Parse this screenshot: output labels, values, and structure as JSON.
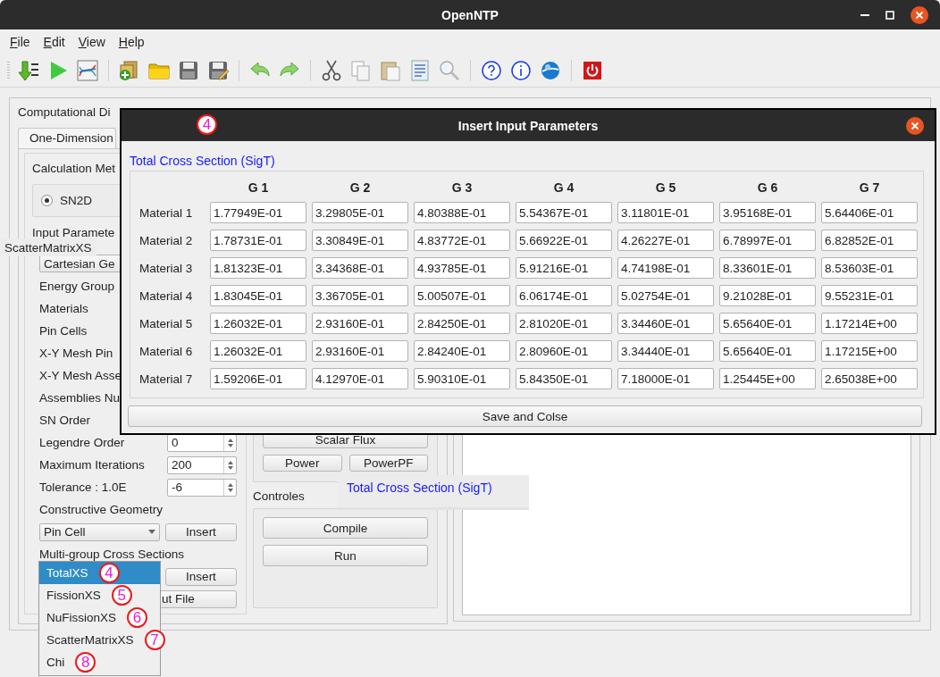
{
  "window": {
    "title": "OpenNTP"
  },
  "menu": [
    "File",
    "Edit",
    "View",
    "Help"
  ],
  "main": {
    "group_title": "Computational Di",
    "tabs": [
      {
        "label": "One-Dimension",
        "selected": true
      }
    ],
    "calculation_method": {
      "label": "Calculation Met",
      "options": [
        {
          "label": "SN2D",
          "selected": true
        }
      ]
    },
    "input_parameters": {
      "label": "Input Paramete",
      "geometry_combo": "Cartesian Ge",
      "fields": [
        {
          "label": "Energy Group"
        },
        {
          "label": "Materials"
        },
        {
          "label": "Pin Cells"
        },
        {
          "label": "X-Y Mesh Pin"
        },
        {
          "label": "X-Y Mesh Asse"
        },
        {
          "label": "Assemblies Nu"
        },
        {
          "label": "SN Order"
        },
        {
          "label": "Legendre Order",
          "value": "0"
        },
        {
          "label": "Maximum Iterations",
          "value": "200"
        },
        {
          "label": "Tolerance : 1.0E",
          "value": "-6"
        }
      ]
    },
    "constructive_geometry": {
      "label": "Constructive Geometry",
      "combo": "Pin Cell",
      "button": "Insert"
    },
    "cross_sections": {
      "label": "Multi-group Cross Sections",
      "button": "Insert"
    },
    "file_button": "ut File",
    "results_buttons": [
      "Scalar Flux",
      "Power",
      "PowerPF"
    ],
    "controls": {
      "label": "Controles",
      "buttons": [
        "Compile",
        "Run"
      ]
    }
  },
  "dropdown": {
    "items": [
      {
        "label": "TotalXS",
        "selected": true,
        "annotation": "4"
      },
      {
        "label": "FissionXS",
        "selected": false,
        "annotation": "5"
      },
      {
        "label": "NuFissionXS",
        "selected": false,
        "annotation": "6"
      },
      {
        "label": "ScatterMatrixXS",
        "selected": false,
        "annotation": "7"
      },
      {
        "label": "Chi",
        "selected": false,
        "annotation": "8"
      }
    ]
  },
  "tooltip": "ScatterMatrixXS",
  "floating_label": "Total Cross Section (SigT)",
  "dialog": {
    "title": "Insert Input Parameters",
    "annotation": "4",
    "section": "Total Cross Section (SigT)",
    "columns": [
      "G 1",
      "G 2",
      "G 3",
      "G 4",
      "G 5",
      "G 6",
      "G 7"
    ],
    "rows": [
      {
        "label": "Material 1",
        "values": [
          "1.77949E-01",
          "3.29805E-01",
          "4.80388E-01",
          "5.54367E-01",
          "3.11801E-01",
          "3.95168E-01",
          "5.64406E-01"
        ]
      },
      {
        "label": "Material 2",
        "values": [
          "1.78731E-01",
          "3.30849E-01",
          "4.83772E-01",
          "5.66922E-01",
          "4.26227E-01",
          "6.78997E-01",
          "6.82852E-01"
        ]
      },
      {
        "label": "Material 3",
        "values": [
          "1.81323E-01",
          "3.34368E-01",
          "4.93785E-01",
          "5.91216E-01",
          "4.74198E-01",
          "8.33601E-01",
          "8.53603E-01"
        ]
      },
      {
        "label": "Material 4",
        "values": [
          "1.83045E-01",
          "3.36705E-01",
          "5.00507E-01",
          "6.06174E-01",
          "5.02754E-01",
          "9.21028E-01",
          "9.55231E-01"
        ]
      },
      {
        "label": "Material 5",
        "values": [
          "1.26032E-01",
          "2.93160E-01",
          "2.84250E-01",
          "2.81020E-01",
          "3.34460E-01",
          "5.65640E-01",
          "1.17214E+00"
        ]
      },
      {
        "label": "Material 6",
        "values": [
          "1.26032E-01",
          "2.93160E-01",
          "2.84240E-01",
          "2.80960E-01",
          "3.34440E-01",
          "5.65640E-01",
          "1.17215E+00"
        ]
      },
      {
        "label": "Material 7",
        "values": [
          "1.59206E-01",
          "4.12970E-01",
          "5.90310E-01",
          "5.84350E-01",
          "7.18000E-01",
          "1.25445E+00",
          "2.65038E+00"
        ]
      }
    ],
    "button": "Save and Colse"
  }
}
